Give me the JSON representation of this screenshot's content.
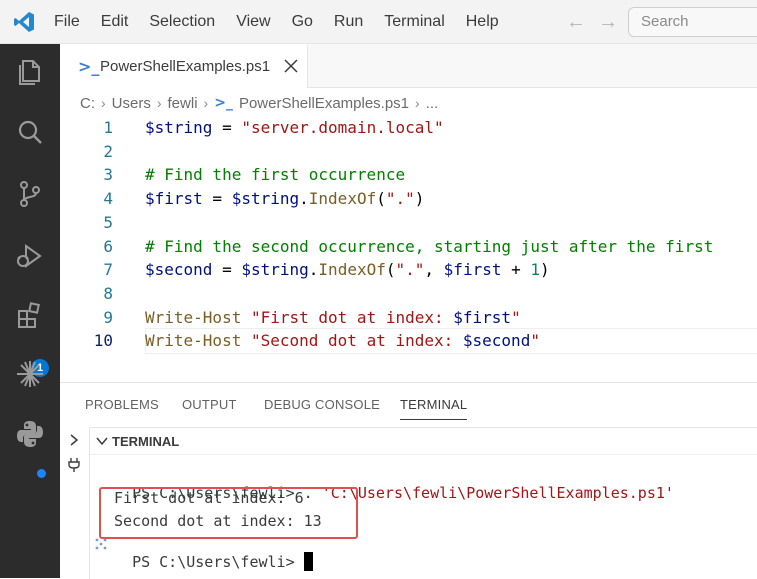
{
  "menu": [
    "File",
    "Edit",
    "Selection",
    "View",
    "Go",
    "Run",
    "Terminal",
    "Help"
  ],
  "search": {
    "placeholder": "Search"
  },
  "activity_bar": {
    "extensions_badge": "1"
  },
  "tab": {
    "label": "PowerShellExamples.ps1"
  },
  "breadcrumb": {
    "parts": [
      "C:",
      "Users",
      "fewli",
      "PowerShellExamples.ps1",
      "..."
    ]
  },
  "editor": {
    "lines": [
      {
        "n": "1",
        "tokens": [
          [
            "var",
            "$string"
          ],
          [
            "op",
            " = "
          ],
          [
            "str",
            "\"server.domain.local\""
          ]
        ]
      },
      {
        "n": "2",
        "tokens": []
      },
      {
        "n": "3",
        "tokens": [
          [
            "com",
            "# Find the first occurrence"
          ]
        ]
      },
      {
        "n": "4",
        "tokens": [
          [
            "var",
            "$first"
          ],
          [
            "op",
            " = "
          ],
          [
            "var",
            "$string"
          ],
          [
            "op",
            "."
          ],
          [
            "fn",
            "IndexOf"
          ],
          [
            "op",
            "("
          ],
          [
            "str",
            "\".\""
          ],
          [
            "op",
            ")"
          ]
        ]
      },
      {
        "n": "5",
        "tokens": []
      },
      {
        "n": "6",
        "tokens": [
          [
            "com",
            "# Find the second occurrence, starting just after the first"
          ]
        ]
      },
      {
        "n": "7",
        "tokens": [
          [
            "var",
            "$second"
          ],
          [
            "op",
            " = "
          ],
          [
            "var",
            "$string"
          ],
          [
            "op",
            "."
          ],
          [
            "fn",
            "IndexOf"
          ],
          [
            "op",
            "("
          ],
          [
            "str",
            "\".\""
          ],
          [
            "op",
            ", "
          ],
          [
            "var",
            "$first"
          ],
          [
            "op",
            " + "
          ],
          [
            "num",
            "1"
          ],
          [
            "op",
            ")"
          ]
        ]
      },
      {
        "n": "8",
        "tokens": []
      },
      {
        "n": "9",
        "tokens": [
          [
            "cmd",
            "Write-Host"
          ],
          [
            "op",
            " "
          ],
          [
            "str",
            "\"First dot at index: "
          ],
          [
            "var",
            "$first"
          ],
          [
            "str",
            "\""
          ]
        ]
      },
      {
        "n": "10",
        "tokens": [
          [
            "cmd",
            "Write-Host"
          ],
          [
            "op",
            " "
          ],
          [
            "str",
            "\"Second dot at index: "
          ],
          [
            "var",
            "$second"
          ],
          [
            "str",
            "\""
          ]
        ]
      }
    ]
  },
  "panel": {
    "tabs": [
      "PROBLEMS",
      "OUTPUT",
      "DEBUG CONSOLE",
      "TERMINAL"
    ],
    "section_title": "TERMINAL",
    "command_prompt": "PS C:\\Users\\fewli> . ",
    "command_path": "'C:\\Users\\fewli\\PowerShellExamples.ps1'",
    "output_1": "First dot at index: 6",
    "output_2": "Second dot at index: 13",
    "prompt": "PS C:\\Users\\fewli> "
  },
  "colors": {
    "accent": "#0078d4",
    "highlight_box": "#e05050",
    "activity_bar": "#2c2c2c"
  }
}
